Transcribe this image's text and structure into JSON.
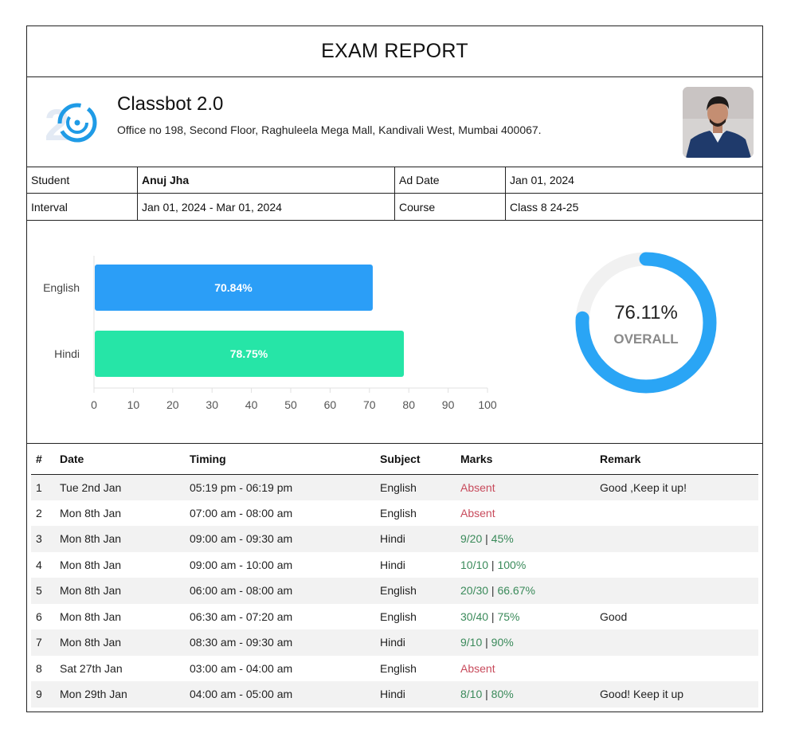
{
  "report_title": "EXAM REPORT",
  "org": {
    "name": "Classbot 2.0",
    "address": "Office no 198, Second Floor, Raghuleela Mega Mall, Kandivali West, Mumbai 400067."
  },
  "info": {
    "student_label": "Student",
    "student_value": "Anuj Jha",
    "ad_date_label": "Ad Date",
    "ad_date_value": "Jan 01, 2024",
    "interval_label": "Interval",
    "interval_value": "Jan 01, 2024 - Mar 01, 2024",
    "course_label": "Course",
    "course_value": "Class 8 24-25"
  },
  "chart_data": [
    {
      "type": "bar",
      "orientation": "horizontal",
      "categories": [
        "English",
        "Hindi"
      ],
      "values": [
        70.84,
        78.75
      ],
      "data_labels": [
        "70.84%",
        "78.75%"
      ],
      "colors": [
        "#2b9ef7",
        "#26e5a7"
      ],
      "xlim": [
        0,
        100
      ],
      "x_ticks": [
        0,
        10,
        20,
        30,
        40,
        50,
        60,
        70,
        80,
        90,
        100
      ]
    },
    {
      "type": "pie",
      "style": "donut",
      "value": 76.11,
      "value_label": "76.11%",
      "center_label": "OVERALL",
      "color": "#2aa5f5",
      "track_color": "#f1f1f1"
    }
  ],
  "table": {
    "headers": [
      "#",
      "Date",
      "Timing",
      "Subject",
      "Marks",
      "Remark"
    ],
    "rows": [
      {
        "n": "1",
        "date": "Tue 2nd Jan",
        "timing": "05:19 pm - 06:19 pm",
        "subject": "English",
        "absent": true,
        "marks": "Absent",
        "pct": "",
        "remark": "Good ,Keep it up!"
      },
      {
        "n": "2",
        "date": "Mon 8th Jan",
        "timing": "07:00 am - 08:00 am",
        "subject": "English",
        "absent": true,
        "marks": "Absent",
        "pct": "",
        "remark": ""
      },
      {
        "n": "3",
        "date": "Mon 8th Jan",
        "timing": "09:00 am - 09:30 am",
        "subject": "Hindi",
        "absent": false,
        "marks": "9/20",
        "pct": "45%",
        "remark": ""
      },
      {
        "n": "4",
        "date": "Mon 8th Jan",
        "timing": "09:00 am - 10:00 am",
        "subject": "Hindi",
        "absent": false,
        "marks": "10/10",
        "pct": "100%",
        "remark": ""
      },
      {
        "n": "5",
        "date": "Mon 8th Jan",
        "timing": "06:00 am - 08:00 am",
        "subject": "English",
        "absent": false,
        "marks": "20/30",
        "pct": "66.67%",
        "remark": ""
      },
      {
        "n": "6",
        "date": "Mon 8th Jan",
        "timing": "06:30 am - 07:20 am",
        "subject": "English",
        "absent": false,
        "marks": "30/40",
        "pct": "75%",
        "remark": "Good"
      },
      {
        "n": "7",
        "date": "Mon 8th Jan",
        "timing": "08:30 am - 09:30 am",
        "subject": "Hindi",
        "absent": false,
        "marks": "9/10",
        "pct": "90%",
        "remark": ""
      },
      {
        "n": "8",
        "date": "Sat 27th Jan",
        "timing": "03:00 am - 04:00 am",
        "subject": "English",
        "absent": true,
        "marks": "Absent",
        "pct": "",
        "remark": ""
      },
      {
        "n": "9",
        "date": "Mon 29th Jan",
        "timing": "04:00 am - 05:00 am",
        "subject": "Hindi",
        "absent": false,
        "marks": "8/10",
        "pct": "80%",
        "remark": "Good! Keep it up"
      }
    ]
  }
}
